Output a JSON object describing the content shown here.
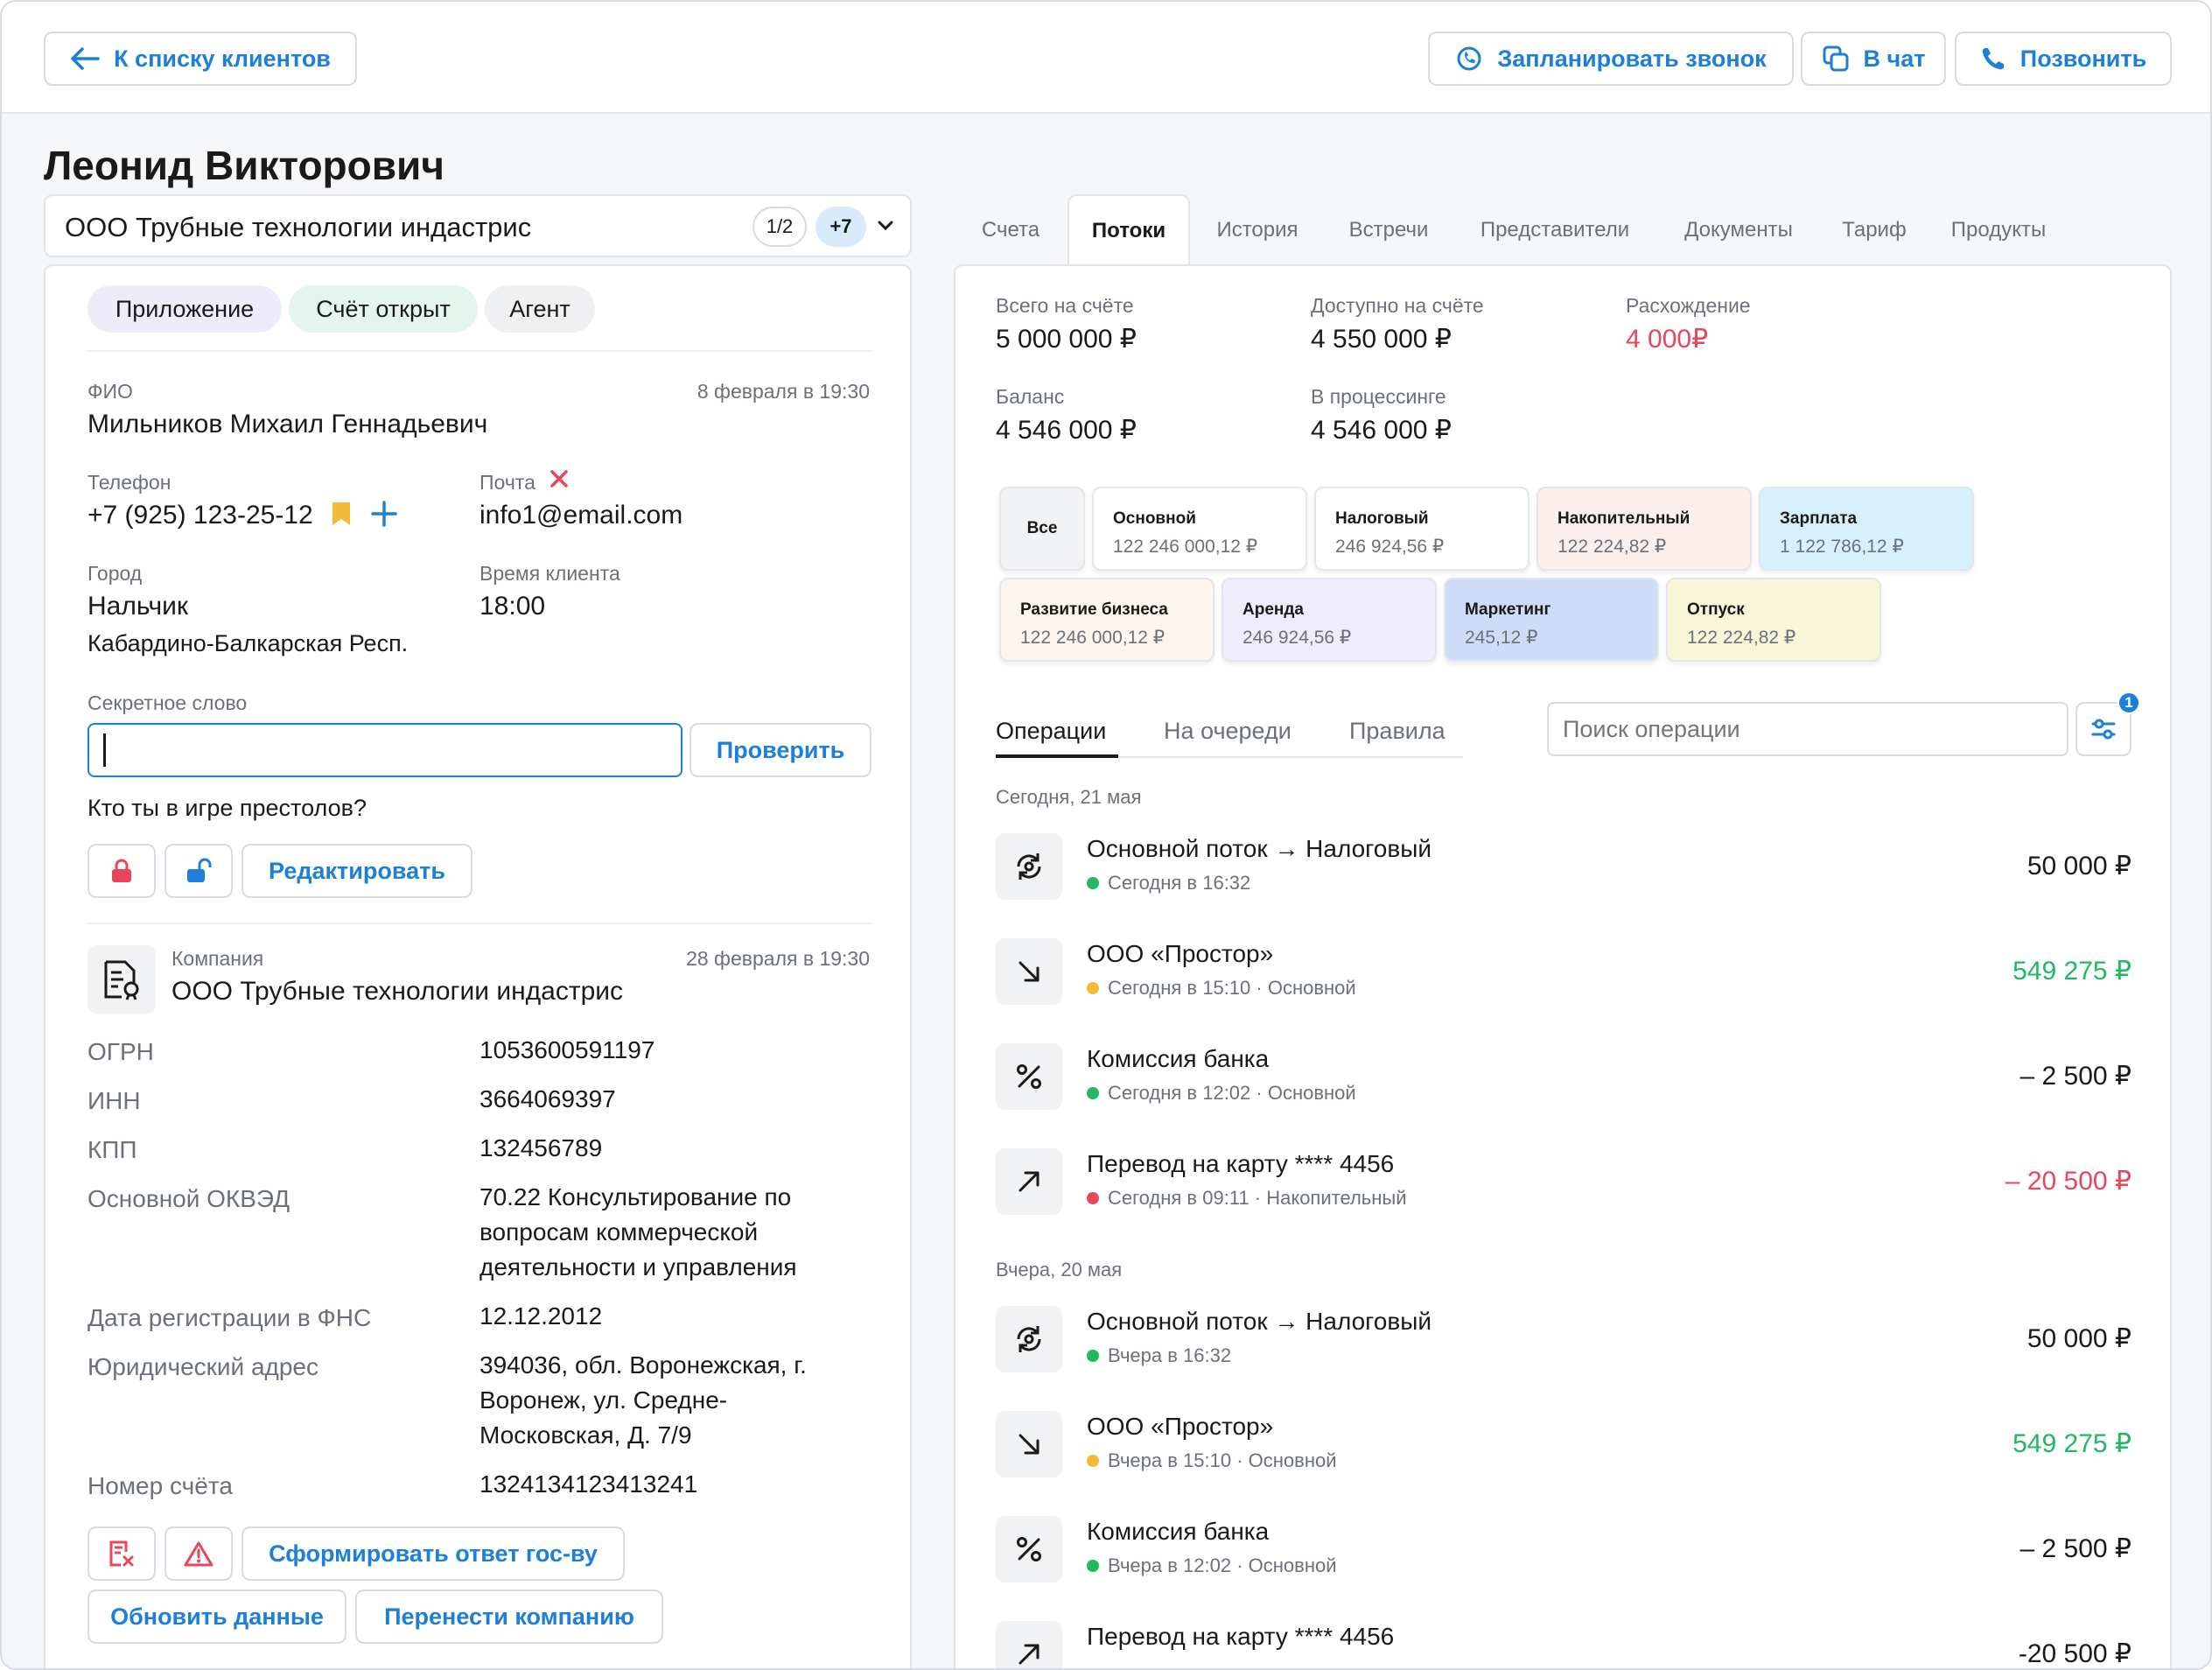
{
  "header": {
    "back_label": "К списку клиентов",
    "schedule_label": "Запланировать звонок",
    "chat_label": "В чат",
    "call_label": "Позвонить"
  },
  "client": {
    "name": "Леонид Викторович",
    "company": "ООО Трубные технологии индастрис",
    "page_counter": "1/2",
    "extra_count": "+7"
  },
  "tags": [
    "Приложение",
    "Счёт открыт",
    "Агент"
  ],
  "person": {
    "fio_label": "ФИО",
    "fio_date": "8 февраля в 19:30",
    "fio": "Мильников Михаил Геннадьевич",
    "phone_label": "Телефон",
    "phone": "+7 (925) 123-25-12",
    "email_label": "Почта",
    "email": "info1@email.com",
    "city_label": "Город",
    "city": "Нальчик",
    "region": "Кабардино-Балкарская Респ.",
    "time_label": "Время клиента",
    "time": "18:00",
    "secret_label": "Секретное слово",
    "check_label": "Проверить",
    "secret_question": "Кто ты в игре престолов?",
    "edit_label": "Редактировать"
  },
  "company": {
    "label": "Компания",
    "date": "28 февраля в 19:30",
    "name": "ООО Трубные технологии индастрис",
    "rows": [
      {
        "label": "ОГРН",
        "value": "1053600591197"
      },
      {
        "label": "ИНН",
        "value": "3664069397"
      },
      {
        "label": "КПП",
        "value": "132456789"
      },
      {
        "label": "Основной ОКВЭД",
        "value": "70.22 Консультирование по вопросам коммерческой деятельности и управления"
      },
      {
        "label": "Дата регистрации в ФНС",
        "value": "12.12.2012"
      },
      {
        "label": "Юридический адрес",
        "value": "394036, обл. Воронежская, г. Воронеж, ул. Средне-Московская, Д. 7/9"
      },
      {
        "label": "Номер счёта",
        "value": "1324134123413241"
      }
    ],
    "form_answer_label": "Сформировать ответ гос-ву",
    "update_label": "Обновить данные",
    "move_label": "Перенести компанию"
  },
  "tabs": [
    "Счета",
    "Потоки",
    "История",
    "Встречи",
    "Представители",
    "Документы",
    "Тариф",
    "Продукты"
  ],
  "summary": {
    "total_label": "Всего на счёте",
    "total": "5 000 000 ₽",
    "available_label": "Доступно на счёте",
    "available": "4 550 000 ₽",
    "diff_label": "Расхождение",
    "diff": "4 000₽",
    "balance_label": "Баланс",
    "balance": "4 546 000 ₽",
    "processing_label": "В процессинге",
    "processing": "4 546 000 ₽"
  },
  "flows": {
    "all_label": "Все",
    "items": [
      {
        "name": "Основной",
        "amount": "122 246 000,12 ₽",
        "color": "#ffffff"
      },
      {
        "name": "Налоговый",
        "amount": "246 924,56 ₽",
        "color": "#ffffff"
      },
      {
        "name": "Накопительный",
        "amount": "122 224,82 ₽",
        "color": "#fdeeee"
      },
      {
        "name": "Зарплата",
        "amount": "1 122 786,12 ₽",
        "color": "#d6f1fb"
      },
      {
        "name": "Развитие бизнеса",
        "amount": "122 246 000,12 ₽",
        "color": "#fdf6ee"
      },
      {
        "name": "Аренда",
        "amount": "246 924,56 ₽",
        "color": "#efedfb"
      },
      {
        "name": "Маркетинг",
        "amount": "245,12 ₽",
        "color": "#cfdcf7"
      },
      {
        "name": "Отпуск",
        "amount": "122 224,82 ₽",
        "color": "#f8f6d8"
      }
    ]
  },
  "subtabs": [
    "Операции",
    "На очереди",
    "Правила"
  ],
  "search": {
    "placeholder": "Поиск операции",
    "filter_badge": "1"
  },
  "days": [
    {
      "label": "Сегодня, 21 мая",
      "ops": [
        {
          "icon": "transfer-cycle-icon",
          "title": "Основной поток → Налоговый",
          "sub": "Сегодня в 16:32",
          "dot": "#20b860",
          "amount": "50 000 ₽",
          "amount_color": "#1a1a1a"
        },
        {
          "icon": "incoming-arrow-icon",
          "title": "ООО «Простор»",
          "sub": "Сегодня в 15:10 · Основной",
          "dot": "#f5b93a",
          "amount": "549 275 ₽",
          "amount_color": "#20b860"
        },
        {
          "icon": "percent-icon",
          "title": "Комиссия банка",
          "sub": "Сегодня в 12:02 · Основной",
          "dot": "#20b860",
          "amount": "– 2 500 ₽",
          "amount_color": "#1a1a1a"
        },
        {
          "icon": "outgoing-arrow-icon",
          "title": "Перевод на карту **** 4456",
          "sub": "Сегодня в 09:11 · Накопительный",
          "dot": "#e8465a",
          "amount": "– 20 500 ₽",
          "amount_color": "#e8465a"
        }
      ]
    },
    {
      "label": "Вчера, 20 мая",
      "ops": [
        {
          "icon": "transfer-cycle-icon",
          "title": "Основной поток → Налоговый",
          "sub": "Вчера в 16:32",
          "dot": "#20b860",
          "amount": "50 000 ₽",
          "amount_color": "#1a1a1a"
        },
        {
          "icon": "incoming-arrow-icon",
          "title": "ООО «Простор»",
          "sub": "Вчера в 15:10 · Основной",
          "dot": "#f5b93a",
          "amount": "549 275 ₽",
          "amount_color": "#20b860"
        },
        {
          "icon": "percent-icon",
          "title": "Комиссия банка",
          "sub": "Вчера в 12:02 · Основной",
          "dot": "#20b860",
          "amount": "– 2 500 ₽",
          "amount_color": "#1a1a1a"
        },
        {
          "icon": "outgoing-arrow-icon",
          "title": "Перевод на карту **** 4456",
          "sub": "",
          "dot": "",
          "amount": "-20 500 ₽",
          "amount_color": "#1a1a1a"
        }
      ]
    }
  ],
  "colors": {
    "accent": "#1e7fd9",
    "danger": "#e8465a",
    "success": "#20b860"
  }
}
